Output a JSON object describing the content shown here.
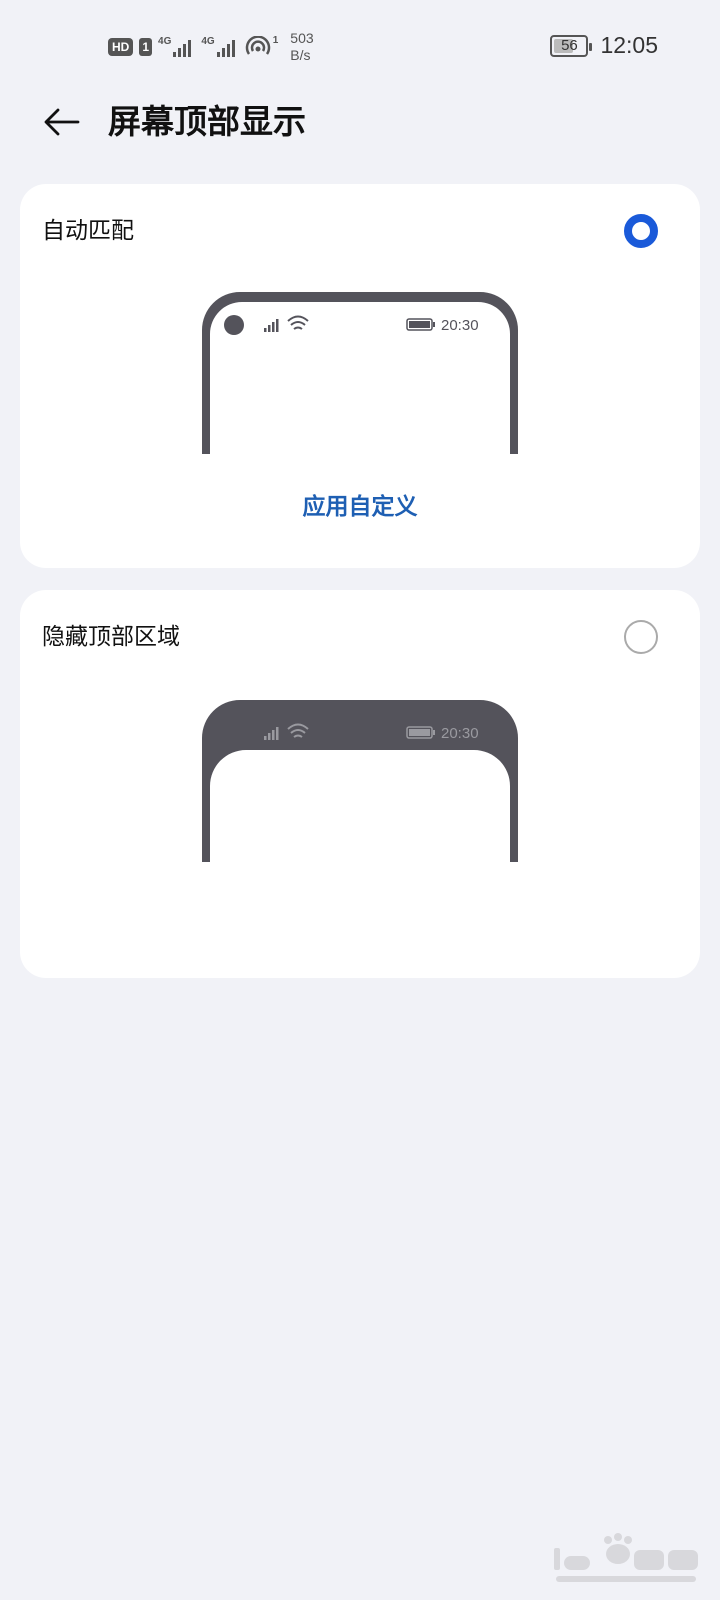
{
  "status_bar": {
    "hd_label": "HD",
    "sim_label": "1",
    "network_1": "4G",
    "network_2": "4G",
    "hotspot_count": "1",
    "speed_value": "503",
    "speed_unit": "B/s",
    "battery_level": "56",
    "battery_fraction": 0.56,
    "time": "12:05"
  },
  "header": {
    "back_icon": "arrow-left-icon",
    "title": "屏幕顶部显示"
  },
  "options": [
    {
      "label": "自动匹配",
      "selected": true,
      "preview_time": "20:30",
      "link_label": "应用自定义"
    },
    {
      "label": "隐藏顶部区域",
      "selected": false,
      "preview_time": "20:30"
    }
  ],
  "colors": {
    "accent": "#1a5ad9",
    "link": "#1e5fb3",
    "background": "#f1f2f7",
    "phone_frame": "#54535b"
  }
}
